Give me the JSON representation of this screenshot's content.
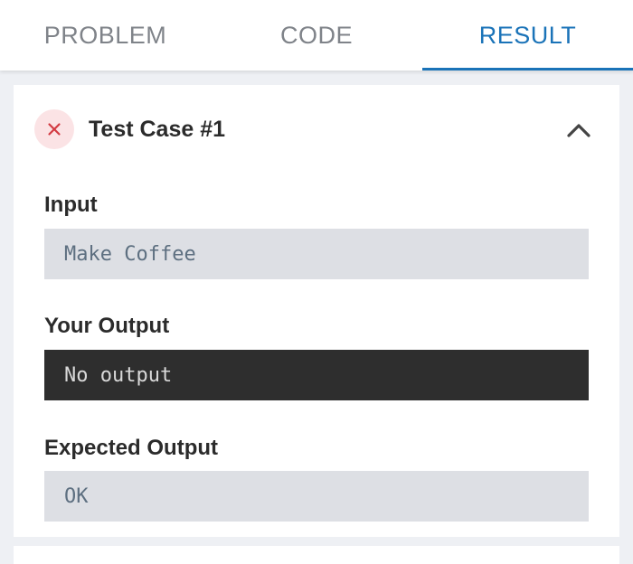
{
  "tabs": [
    {
      "label": "PROBLEM",
      "active": false
    },
    {
      "label": "CODE",
      "active": false
    },
    {
      "label": "RESULT",
      "active": true
    }
  ],
  "colors": {
    "accent": "#1a73b8",
    "fail_icon": "#d33b43",
    "fail_badge_bg": "#fbe3e5"
  },
  "test_case": {
    "title": "Test Case #1",
    "status": "failed",
    "status_icon": "close-icon",
    "toggle_icon": "chevron-up-icon",
    "input_label": "Input",
    "input_value": "Make Coffee",
    "output_label": "Your Output",
    "output_value": "No output",
    "expected_label": "Expected Output",
    "expected_value": "OK"
  }
}
